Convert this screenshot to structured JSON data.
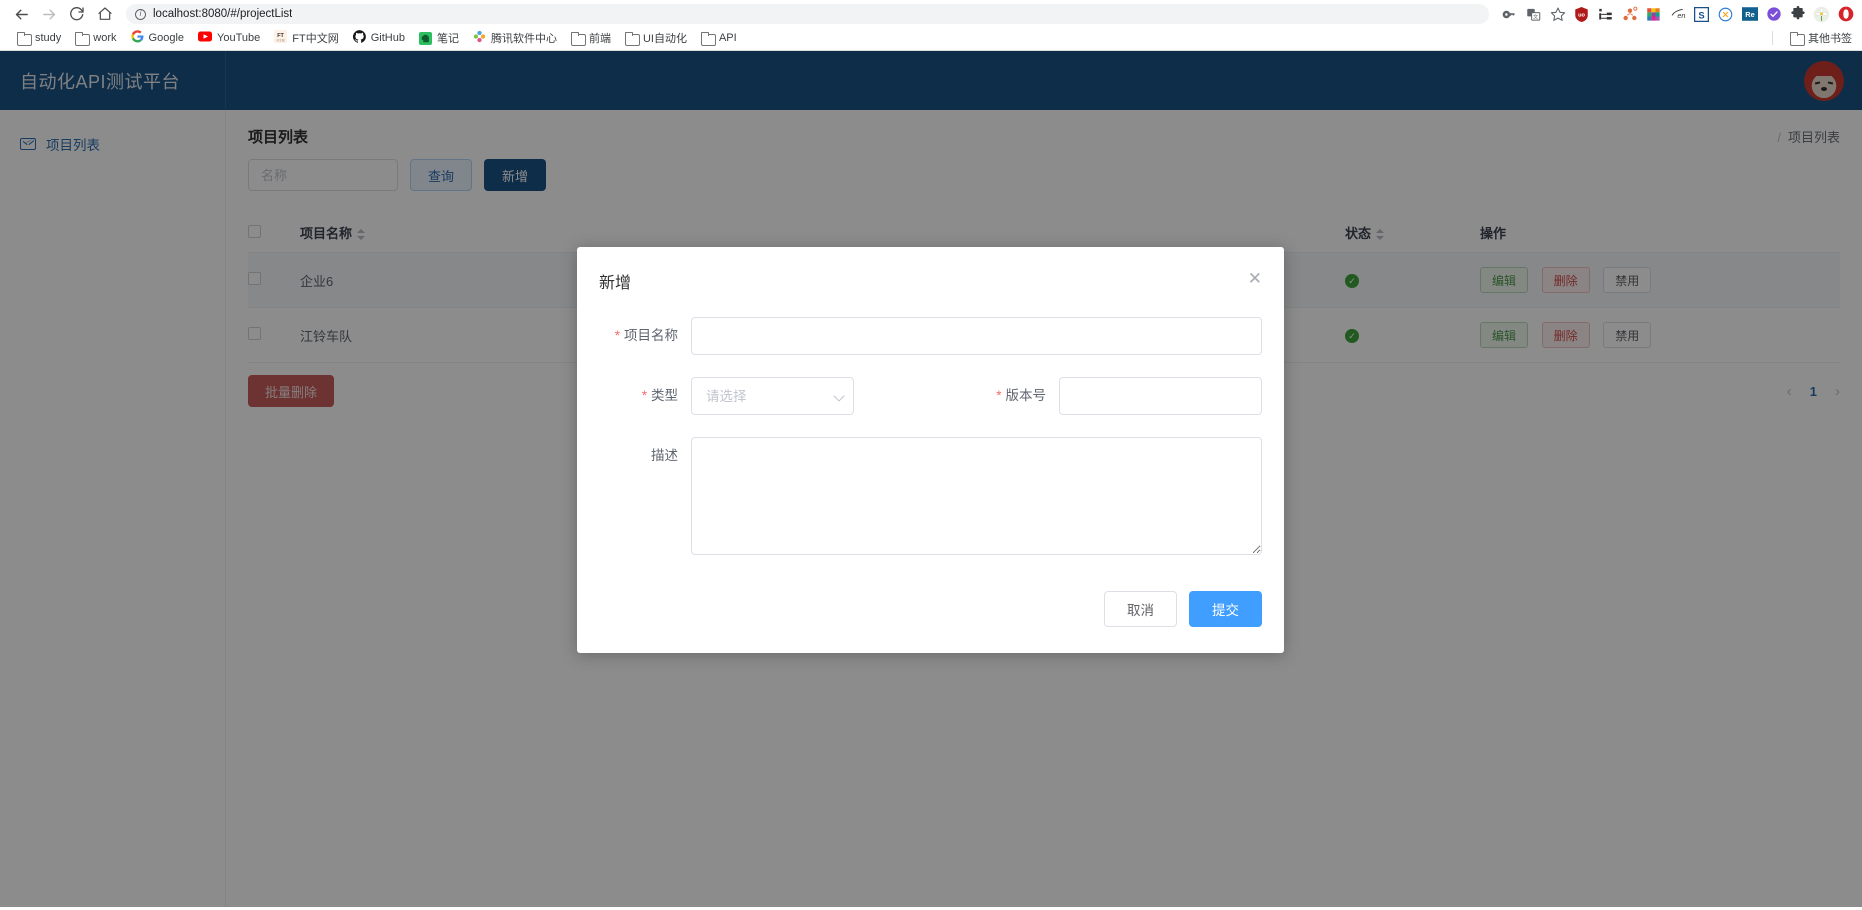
{
  "browser": {
    "url": "localhost:8080/#/projectList",
    "nav": {
      "back": "back-arrow",
      "forward": "forward-arrow",
      "reload": "reload",
      "home": "home"
    },
    "toolbar_icons": [
      "key-icon",
      "translate-icon",
      "star-icon",
      "ublock-icon",
      "tree-icon",
      "sitemap-icon",
      "palette-icon",
      "en-icon",
      "s-icon",
      "compass-icon",
      "re-icon",
      "check-badge-icon",
      "puzzle-icon",
      "flower-icon",
      "opera-icon"
    ],
    "bookmarks": [
      {
        "label": "study",
        "icon": "folder-icon",
        "color": "#757575"
      },
      {
        "label": "work",
        "icon": "folder-icon",
        "color": "#757575"
      },
      {
        "label": "Google",
        "icon": "google-icon",
        "color": "#4285f4"
      },
      {
        "label": "YouTube",
        "icon": "youtube-icon",
        "color": "#ff0000"
      },
      {
        "label": "FT中文网",
        "icon": "ft-icon",
        "color": "#fff1e5"
      },
      {
        "label": "GitHub",
        "icon": "github-icon",
        "color": "#181717"
      },
      {
        "label": "笔记",
        "icon": "evernote-icon",
        "color": "#2dbe60"
      },
      {
        "label": "腾讯软件中心",
        "icon": "tencent-icon",
        "color": "#4aa3df"
      },
      {
        "label": "前端",
        "icon": "folder-icon",
        "color": "#757575"
      },
      {
        "label": "UI自动化",
        "icon": "folder-icon",
        "color": "#757575"
      },
      {
        "label": "API",
        "icon": "folder-icon",
        "color": "#757575"
      }
    ],
    "other_bookmarks": {
      "label": "其他书签",
      "icon": "folder-icon"
    }
  },
  "app": {
    "title": "自动化API测试平台",
    "header_color": "#1b5386",
    "avatar": "user-avatar"
  },
  "sidebar": {
    "items": [
      {
        "label": "项目列表",
        "icon": "envelope-icon",
        "active": true
      }
    ]
  },
  "main": {
    "panel_title": "项目列表",
    "breadcrumb": {
      "separator": "/",
      "current": "项目列表"
    },
    "search": {
      "placeholder": "名称",
      "value": "",
      "query_label": "查询",
      "add_label": "新增"
    },
    "table": {
      "columns": [
        "项目名称",
        "状态",
        "操作"
      ],
      "rows": [
        {
          "name": "企业6",
          "status": "enabled",
          "status_icon": "check-circle-icon",
          "highlighted": true,
          "actions": [
            "编辑",
            "删除",
            "禁用"
          ]
        },
        {
          "name": "江铃车队",
          "status": "enabled",
          "status_icon": "check-circle-icon",
          "highlighted": false,
          "actions": [
            "编辑",
            "删除",
            "禁用"
          ]
        }
      ]
    },
    "batch_delete_label": "批量删除",
    "pagination": {
      "prev": "‹",
      "page": "1",
      "next": "›"
    }
  },
  "modal": {
    "title": "新增",
    "close_icon": "close-icon",
    "fields": {
      "project_name": {
        "label": "项目名称",
        "required": true,
        "value": "",
        "placeholder": ""
      },
      "type": {
        "label": "类型",
        "required": true,
        "value": "",
        "placeholder": "请选择",
        "chevron": "chevron-down-icon"
      },
      "version": {
        "label": "版本号",
        "required": true,
        "value": "",
        "placeholder": ""
      },
      "description": {
        "label": "描述",
        "required": false,
        "value": "",
        "placeholder": ""
      }
    },
    "buttons": {
      "cancel": "取消",
      "submit": "提交"
    },
    "submit_color": "#409eff"
  }
}
